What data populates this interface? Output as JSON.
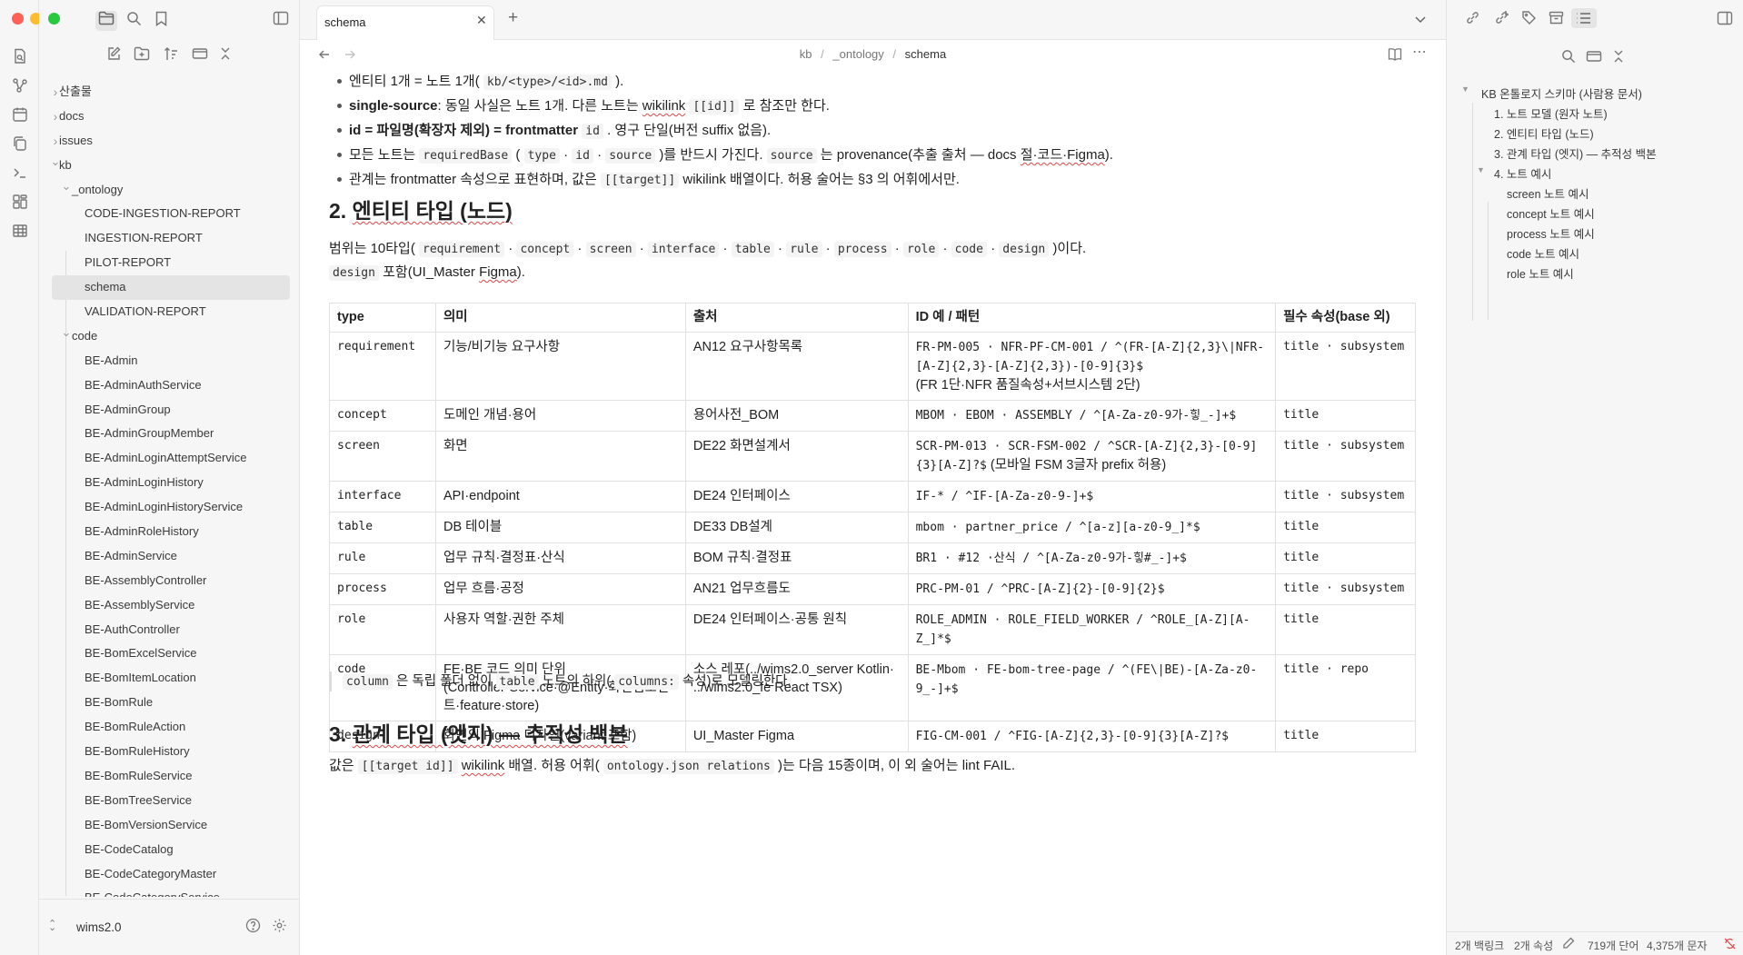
{
  "window": {
    "traffic_lights": [
      "#fe5f57",
      "#febc2e",
      "#28c840"
    ]
  },
  "ribbon": {
    "icons": [
      "file-search-icon",
      "graph-icon",
      "calendar-icon",
      "copy-icon",
      "terminal-icon",
      "kanban-icon",
      "table-icon"
    ]
  },
  "sidebar": {
    "top_icons": [
      "folder-icon",
      "search-icon",
      "bookmark-icon"
    ],
    "toolbar_icons": [
      "new-note-icon",
      "new-folder-icon",
      "sort-icon",
      "collapse-view-icon",
      "collapse-all-icon"
    ],
    "tree": [
      {
        "label": "산출물",
        "depth": 0,
        "type": "folder",
        "expanded": false
      },
      {
        "label": "docs",
        "depth": 0,
        "type": "folder",
        "expanded": false
      },
      {
        "label": "issues",
        "depth": 0,
        "type": "folder",
        "expanded": false
      },
      {
        "label": "kb",
        "depth": 0,
        "type": "folder",
        "expanded": true
      },
      {
        "label": "_ontology",
        "depth": 1,
        "type": "folder",
        "expanded": true
      },
      {
        "label": "CODE-INGESTION-REPORT",
        "depth": 2,
        "type": "file"
      },
      {
        "label": "INGESTION-REPORT",
        "depth": 2,
        "type": "file"
      },
      {
        "label": "PILOT-REPORT",
        "depth": 2,
        "type": "file"
      },
      {
        "label": "schema",
        "depth": 2,
        "type": "file",
        "selected": true
      },
      {
        "label": "VALIDATION-REPORT",
        "depth": 2,
        "type": "file"
      },
      {
        "label": "code",
        "depth": 1,
        "type": "folder",
        "expanded": true
      },
      {
        "label": "BE-Admin",
        "depth": 2,
        "type": "file"
      },
      {
        "label": "BE-AdminAuthService",
        "depth": 2,
        "type": "file"
      },
      {
        "label": "BE-AdminGroup",
        "depth": 2,
        "type": "file"
      },
      {
        "label": "BE-AdminGroupMember",
        "depth": 2,
        "type": "file"
      },
      {
        "label": "BE-AdminLoginAttemptService",
        "depth": 2,
        "type": "file"
      },
      {
        "label": "BE-AdminLoginHistory",
        "depth": 2,
        "type": "file"
      },
      {
        "label": "BE-AdminLoginHistoryService",
        "depth": 2,
        "type": "file"
      },
      {
        "label": "BE-AdminRoleHistory",
        "depth": 2,
        "type": "file"
      },
      {
        "label": "BE-AdminService",
        "depth": 2,
        "type": "file"
      },
      {
        "label": "BE-AssemblyController",
        "depth": 2,
        "type": "file"
      },
      {
        "label": "BE-AssemblyService",
        "depth": 2,
        "type": "file"
      },
      {
        "label": "BE-AuthController",
        "depth": 2,
        "type": "file"
      },
      {
        "label": "BE-BomExcelService",
        "depth": 2,
        "type": "file"
      },
      {
        "label": "BE-BomItemLocation",
        "depth": 2,
        "type": "file"
      },
      {
        "label": "BE-BomRule",
        "depth": 2,
        "type": "file"
      },
      {
        "label": "BE-BomRuleAction",
        "depth": 2,
        "type": "file"
      },
      {
        "label": "BE-BomRuleHistory",
        "depth": 2,
        "type": "file"
      },
      {
        "label": "BE-BomRuleService",
        "depth": 2,
        "type": "file"
      },
      {
        "label": "BE-BomTreeService",
        "depth": 2,
        "type": "file"
      },
      {
        "label": "BE-BomVersionService",
        "depth": 2,
        "type": "file"
      },
      {
        "label": "BE-CodeCatalog",
        "depth": 2,
        "type": "file"
      },
      {
        "label": "BE-CodeCategoryMaster",
        "depth": 2,
        "type": "file"
      },
      {
        "label": "BE-CodeCategoryService",
        "depth": 2,
        "type": "file"
      }
    ],
    "vault_name": "wims2.0"
  },
  "tab": {
    "title": "schema"
  },
  "nav": {
    "breadcrumb": [
      "kb",
      "_ontology",
      "schema"
    ],
    "separator": "/"
  },
  "doc": {
    "bullets": [
      {
        "parts": [
          {
            "t": "엔티티 1개 = 노트 1개( "
          },
          {
            "c": "kb/<type>/<id>.md"
          },
          {
            "t": " )."
          }
        ]
      },
      {
        "parts": [
          {
            "b": "single-source"
          },
          {
            "t": ": 동일 사실은 노트 1개. 다른 노트는 "
          },
          {
            "w": "wikilink"
          },
          {
            "t": " "
          },
          {
            "c": "[[id]]"
          },
          {
            "t": " 로 참조만 한다."
          }
        ]
      },
      {
        "parts": [
          {
            "b": "id = 파일명(확장자 제외) = frontmatter "
          },
          {
            "c": "id"
          },
          {
            "t": " . 영구 단일(버전 suffix 없음)."
          }
        ]
      },
      {
        "parts": [
          {
            "t": "모든 노트는 "
          },
          {
            "c": "requiredBase"
          },
          {
            "t": " ( "
          },
          {
            "c": "type"
          },
          {
            "t": " · "
          },
          {
            "c": "id"
          },
          {
            "t": " · "
          },
          {
            "c": "source"
          },
          {
            "t": " )를 반드시 가진다. "
          },
          {
            "c": "source"
          },
          {
            "t": " 는 provenance(추출 출처 — docs "
          },
          {
            "w": "절·코드·Figma"
          },
          {
            "t": ")."
          }
        ]
      },
      {
        "parts": [
          {
            "t": "관계는 frontmatter 속성으로 표현하며, 값은 "
          },
          {
            "c": "[[target]]"
          },
          {
            "t": " wikilink 배열이다. 허용 술어는 §3 의 어휘에서만."
          }
        ]
      }
    ],
    "h2_entities": {
      "num": "2. ",
      "title": "엔티티 타입 (노드)"
    },
    "intro_line1": [
      {
        "t": "범위는 10타입( "
      },
      {
        "c": "requirement"
      },
      {
        "t": " · "
      },
      {
        "c": "concept"
      },
      {
        "t": " · "
      },
      {
        "c": "screen"
      },
      {
        "t": " · "
      },
      {
        "c": "interface"
      },
      {
        "t": " · "
      },
      {
        "c": "table"
      },
      {
        "t": " · "
      },
      {
        "c": "rule"
      },
      {
        "t": " · "
      },
      {
        "c": "process"
      },
      {
        "t": " · "
      },
      {
        "c": "role"
      },
      {
        "t": " · "
      },
      {
        "c": "code"
      },
      {
        "t": " · "
      },
      {
        "c": "design"
      },
      {
        "t": " )이다."
      }
    ],
    "intro_line2": [
      {
        "c": "design"
      },
      {
        "t": " 포함(UI_Master "
      },
      {
        "w": "Figma"
      },
      {
        "t": ")."
      }
    ],
    "table": {
      "headers": [
        "type",
        "의미",
        "출처",
        "ID 예 / 패턴",
        "필수 속성(base 외)"
      ],
      "rows": [
        {
          "type": "requirement",
          "meaning": "기능/비기능 요구사항",
          "source": "AN12 요구사항목록",
          "id_pattern": "FR-PM-005 · NFR-PF-CM-001 / ^(FR-[A-Z]{2,3}\\|NFR-[A-Z]{2,3}-[A-Z]{2,3})-[0-9]{3}$",
          "id_note": "(FR 1단·NFR 품질속성+서브시스템 2단)",
          "required": "title · subsystem"
        },
        {
          "type": "concept",
          "meaning": "도메인 개념·용어",
          "source": "용어사전_BOM",
          "id_pattern": "MBOM · EBOM · ASSEMBLY / ^[A-Za-z0-9가-힣_-]+$",
          "id_note": "",
          "required": "title"
        },
        {
          "type": "screen",
          "meaning": "화면",
          "source": "DE22 화면설계서",
          "id_pattern": "SCR-PM-013 · SCR-FSM-002 / ^SCR-[A-Z]{2,3}-[0-9]{3}[A-Z]?$",
          "id_note": " (모바일 FSM 3글자 prefix 허용)",
          "required": "title · subsystem"
        },
        {
          "type": "interface",
          "meaning": "API·endpoint",
          "source": "DE24 인터페이스",
          "id_pattern": "IF-* / ^IF-[A-Za-z0-9-]+$",
          "id_note": "",
          "required": "title · subsystem"
        },
        {
          "type": "table",
          "meaning": "DB 테이블",
          "source": "DE33 DB설계",
          "id_pattern": "mbom · partner_price / ^[a-z][a-z0-9_]*$",
          "id_note": "",
          "required": "title"
        },
        {
          "type": "rule",
          "meaning": "업무 규칙·결정표·산식",
          "source": "BOM 규칙·결정표",
          "id_pattern": "BR1 · #12 ·산식 / ^[A-Za-z0-9가-힣#_-]+$",
          "id_note": "",
          "required": "title"
        },
        {
          "type": "process",
          "meaning": "업무 흐름·공정",
          "source": "AN21 업무흐름도",
          "id_pattern": "PRC-PM-01 / ^PRC-[A-Z]{2}-[0-9]{2}$",
          "id_note": "",
          "required": "title · subsystem"
        },
        {
          "type": "role",
          "meaning": "사용자 역할·권한 주체",
          "source": "DE24 인터페이스·공통 원칙",
          "id_pattern": "ROLE_ADMIN · ROLE_FIELD_WORKER / ^ROLE_[A-Z][A-Z_]*$",
          "id_note": "",
          "required": "title"
        },
        {
          "type": "code",
          "meaning": "FE·BE 코드 의미 단위(Controller·Service·@Entity·화면컴포넌트·feature·store)",
          "source": "소스 레포(../wims2.0_server Kotlin· ../wims2.0_fe React TSX)",
          "id_pattern": "BE-Mbom · FE-bom-tree-page / ^(FE\\|BE)-[A-Za-z0-9_-]+$",
          "id_note": "",
          "required": "title · repo"
        },
        {
          "type": "design",
          "meaning": "화면의 Figma 디자인(variant 포함)",
          "source": "UI_Master Figma",
          "id_pattern": "FIG-CM-001 / ^FIG-[A-Z]{2,3}-[0-9]{3}[A-Z]?$",
          "id_note": "",
          "required": "title"
        }
      ]
    },
    "callout": [
      {
        "c": "column"
      },
      {
        "t": " 은 독립 폴더 없이 "
      },
      {
        "c": "table"
      },
      {
        "t": " 노트의 하위( "
      },
      {
        "c": "columns:"
      },
      {
        "t": " 속성)로 모델링한다."
      }
    ],
    "h2_relations": {
      "num": "3. ",
      "title": "관계 타입 (엣지) — 추적성 백본"
    },
    "relations_line": [
      {
        "t": "값은 "
      },
      {
        "c": "[[target id]]"
      },
      {
        "t": " "
      },
      {
        "w": "wikilink"
      },
      {
        "t": " 배열. 허용 어휘( "
      },
      {
        "c": "ontology.json relations"
      },
      {
        "t": " )는 다음 15종이며, 이 외 술어는 lint FAIL."
      }
    ]
  },
  "outline": {
    "title": "KB 온톨로지 스키마 (사람용 문서)",
    "items": [
      {
        "label": "1. 노트 모델 (원자 노트)",
        "level": 1
      },
      {
        "label": "2. 엔티티 타입 (노드)",
        "level": 1
      },
      {
        "label": "3. 관계 타입 (엣지) — 추적성 백본",
        "level": 1
      },
      {
        "label": "4. 노트 예시",
        "level": 1
      },
      {
        "label": "screen 노트 예시",
        "level": 2
      },
      {
        "label": "concept 노트 예시",
        "level": 2
      },
      {
        "label": "process 노트 예시",
        "level": 2
      },
      {
        "label": "code 노트 예시",
        "level": 2
      },
      {
        "label": "role 노트 예시",
        "level": 2
      }
    ]
  },
  "status": {
    "backlinks": "2개 백링크",
    "properties": "2개 속성",
    "words": "719개 단어",
    "chars": "4,375개 문자"
  }
}
